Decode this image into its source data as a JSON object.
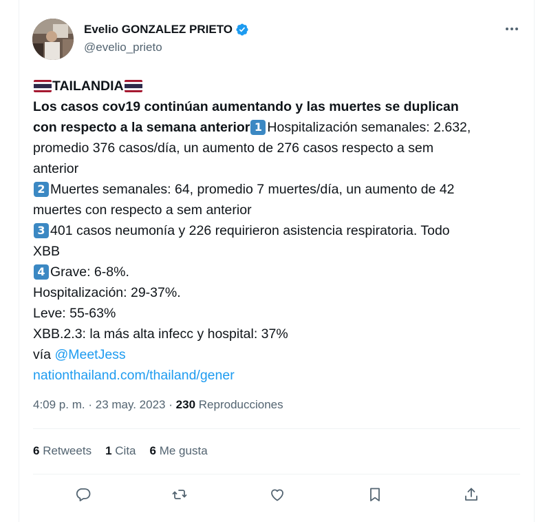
{
  "author": {
    "display_name": "Evelio GONZALEZ PRIETO",
    "handle": "@evelio_prieto"
  },
  "tweet": {
    "country": "TAILANDIA",
    "headline_1": "Los casos cov19 continúan aumentando y las muertes se duplican",
    "headline_2": "con respecto a la semana anterior",
    "kc1": "1",
    "p1_a": "Hospitalización semanales: 2.632,",
    "p1_b": "promedio 376 casos/día, un aumento de 276 casos respecto a sem",
    "p1_c": "anterior",
    "kc2": "2",
    "p2_a": "Muertes semanales: 64, promedio 7 muertes/día, un aumento de 42",
    "p2_b": "muertes con respecto a sem anterior",
    "kc3": "3",
    "p3_a": "401 casos neumonía y 226 requirieron asistencia respiratoria. Todo",
    "p3_b": "XBB",
    "kc4": "4",
    "p4_a": "Grave: 6-8%.",
    "p4_b": "Hospitalización: 29-37%.",
    "p4_c": "Leve: 55-63%",
    "p4_d": "XBB.2.3: la más alta infecc y hospital: 37%",
    "via_label": "vía",
    "mention": "@MeetJess",
    "link": "nationthailand.com/thailand/gener"
  },
  "meta": {
    "time": "4:09 p. m.",
    "sep": "·",
    "date": "23 may. 2023",
    "views_count": "230",
    "views_label": "Reproducciones"
  },
  "stats": {
    "retweets_count": "6",
    "retweets_label": "Retweets",
    "quotes_count": "1",
    "quotes_label": "Cita",
    "likes_count": "6",
    "likes_label": "Me gusta"
  },
  "icons": {
    "reply": "reply-icon",
    "retweet": "retweet-icon",
    "like": "heart-icon",
    "bookmark": "bookmark-icon",
    "share": "share-icon",
    "verified": "verified-badge-icon",
    "more": "more-options-icon"
  },
  "colors": {
    "link": "#1d9bf0",
    "keycap": "#3b88c3",
    "secondary_text": "#536471"
  }
}
